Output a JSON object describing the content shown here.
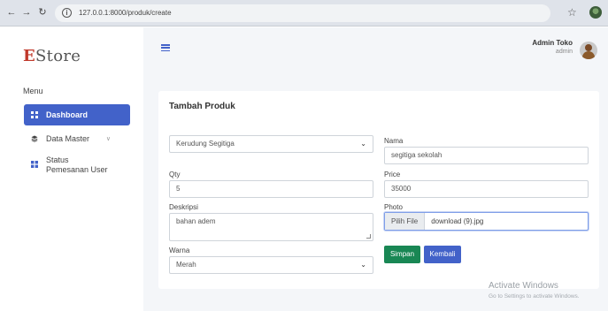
{
  "browser": {
    "url": "127.0.0.1:8000/produk/create"
  },
  "sidebar": {
    "logo_first": "E",
    "logo_rest": "Store",
    "menu_heading": "Menu",
    "items": [
      {
        "label": "Dashboard",
        "icon": "grid-icon"
      },
      {
        "label": "Data Master",
        "icon": "layers-icon"
      },
      {
        "label": "Status Pemesanan User",
        "icon": "table-icon"
      }
    ]
  },
  "header": {
    "user_name": "Admin Toko",
    "user_role": "admin"
  },
  "form": {
    "title": "Tambah Produk",
    "category_value": "Kerudung Segitiga",
    "nama_label": "Nama",
    "nama_value": "segitiga sekolah",
    "qty_label": "Qty",
    "qty_value": "5",
    "price_label": "Price",
    "price_value": "35000",
    "deskripsi_label": "Deskripsi",
    "deskripsi_value": "bahan adem",
    "photo_label": "Photo",
    "photo_button": "Pilih File",
    "photo_filename": "download (9).jpg",
    "warna_label": "Warna",
    "warna_value": "Merah",
    "save_label": "Simpan",
    "back_label": "Kembali"
  },
  "watermark": {
    "line1": "Activate Windows",
    "line2": "Go to Settings to activate Windows."
  },
  "colors": {
    "primary": "#4262c9",
    "success": "#198754",
    "logo_accent": "#c0392b"
  }
}
